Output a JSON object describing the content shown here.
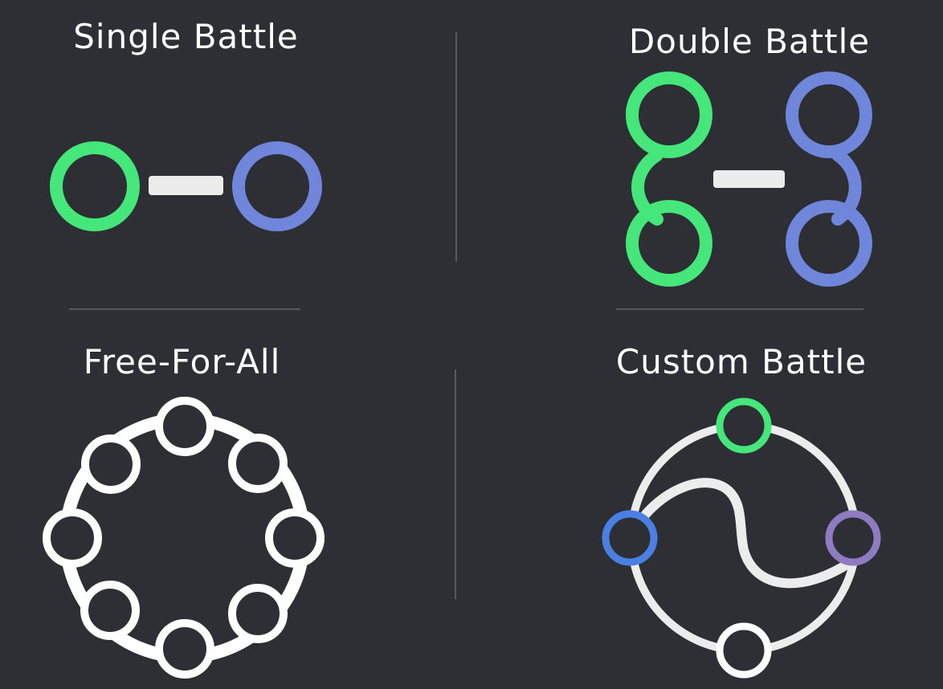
{
  "modes": {
    "single": {
      "label": "Single Battle"
    },
    "double": {
      "label": "Double Battle"
    },
    "ffa": {
      "label": "Free-For-All"
    },
    "custom": {
      "label": "Custom Battle"
    }
  },
  "colors": {
    "background": "#2d2f34",
    "green": "#45e77b",
    "blue": "#6f86db",
    "white": "#ffffff",
    "light_gray": "#ececec",
    "bright_blue": "#4a7fe3",
    "purple": "#8f7bc2",
    "divider": "#55585e"
  },
  "icons": {
    "single": "one-vs-one-icon",
    "double": "two-vs-two-icon",
    "ffa": "free-for-all-ring-icon",
    "custom": "custom-battle-circle-icon"
  }
}
